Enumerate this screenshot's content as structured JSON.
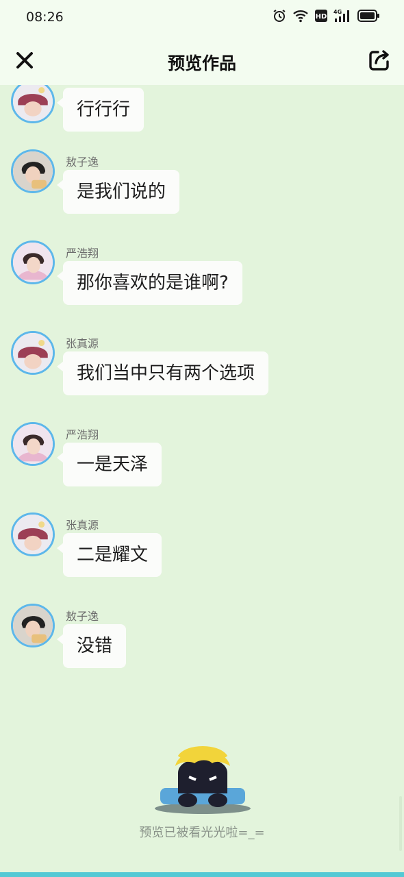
{
  "status_bar": {
    "time": "08:26",
    "network_label": "4G"
  },
  "header": {
    "title": "预览作品"
  },
  "messages": [
    {
      "sender": "",
      "text": "行行行",
      "avatar": "zhang"
    },
    {
      "sender": "敖子逸",
      "text": "是我们说的",
      "avatar": "ao"
    },
    {
      "sender": "严浩翔",
      "text": "那你喜欢的是谁啊?",
      "avatar": "yan"
    },
    {
      "sender": "张真源",
      "text": "我们当中只有两个选项",
      "avatar": "zhang"
    },
    {
      "sender": "严浩翔",
      "text": "一是天泽",
      "avatar": "yan"
    },
    {
      "sender": "张真源",
      "text": "二是耀文",
      "avatar": "zhang"
    },
    {
      "sender": "敖子逸",
      "text": "没错",
      "avatar": "ao"
    }
  ],
  "footer": {
    "end_text": "预览已被看光光啦=_="
  },
  "colors": {
    "background": "#e3f4dc",
    "header": "#f3fcf0",
    "avatar_ring": "#5db7ea",
    "bubble": "#fbfcfa",
    "bottom_strip": "#54c9d4"
  }
}
